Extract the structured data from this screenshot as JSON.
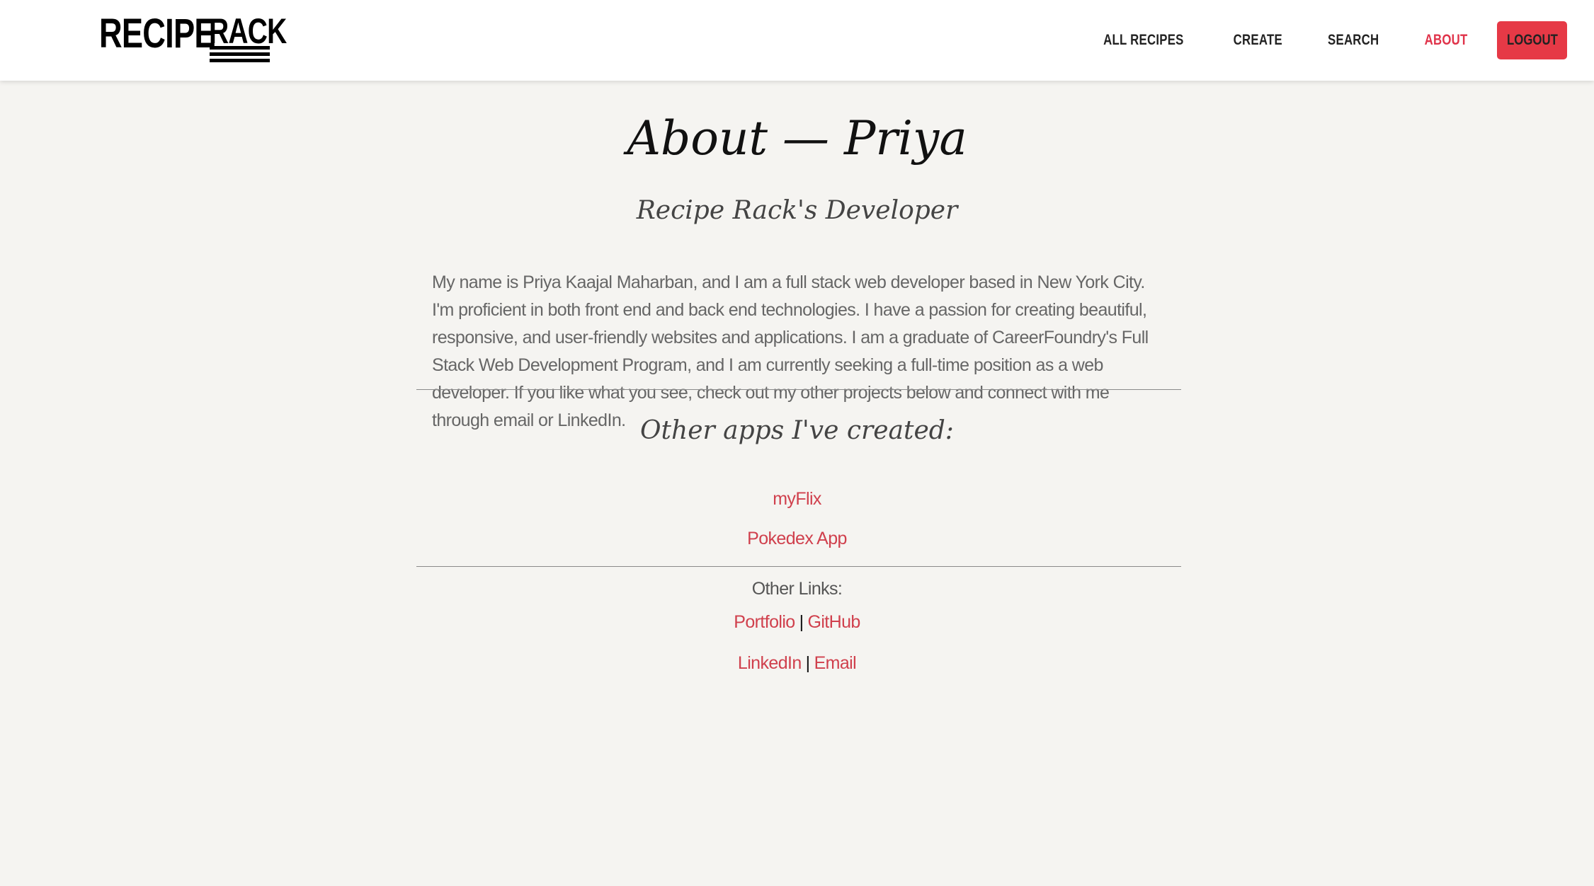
{
  "brand": {
    "word1": "RECIPE",
    "word2": "RACK"
  },
  "nav": {
    "items": [
      {
        "label": "ALL RECIPES"
      },
      {
        "label": "CREATE"
      },
      {
        "label": "SEARCH"
      },
      {
        "label": "ABOUT"
      }
    ],
    "active": "ABOUT",
    "logout_label": "LOGOUT"
  },
  "colors": {
    "accent": "#e63946",
    "link": "#d0404d",
    "background": "#f5f4f1"
  },
  "page": {
    "title": "About — Priya",
    "subtitle": "Recipe Rack's Developer",
    "bio": "My name is Priya Kaajal Maharban, and I am a full stack web developer based in New York City. I'm proficient in both front end and back end technologies. I have a passion for creating beautiful, responsive, and user-friendly websites and applications. I am a graduate of CareerFoundry's Full Stack Web Development Program, and I am currently seeking a full-time position as a web developer. If you like what you see, check out my other projects below and connect with me through email or LinkedIn.",
    "apps_heading": "Other apps I've created:",
    "apps": [
      {
        "label": "myFlix"
      },
      {
        "label": "Pokedex App"
      }
    ],
    "other_links_label": "Other Links:",
    "links_row1": [
      {
        "label": "Portfolio"
      },
      {
        "label": "GitHub"
      }
    ],
    "links_row2": [
      {
        "label": "LinkedIn"
      },
      {
        "label": "Email"
      }
    ],
    "separator": "|"
  }
}
